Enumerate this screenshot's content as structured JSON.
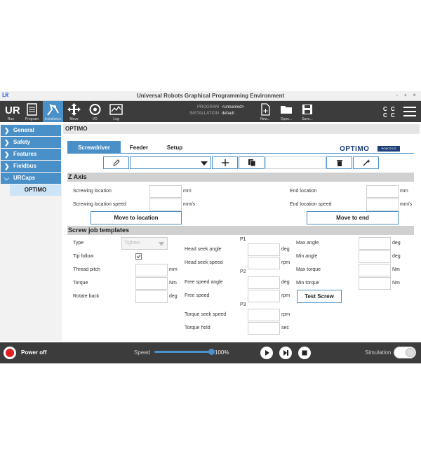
{
  "window": {
    "title": "Universal Robots Graphical Programming Environment",
    "controls": "- + ×"
  },
  "header": {
    "tabs": [
      {
        "label": "Run"
      },
      {
        "label": "Program"
      },
      {
        "label": "Installation"
      },
      {
        "label": "Move"
      },
      {
        "label": "I/O"
      },
      {
        "label": "Log"
      }
    ],
    "program_label": "PROGRAM",
    "program_value": "<unnamed>",
    "installation_label": "INSTALLATION",
    "installation_value": "default",
    "file_buttons": [
      {
        "label": "New..."
      },
      {
        "label": "Open..."
      },
      {
        "label": "Save..."
      }
    ]
  },
  "sidebar": {
    "items": [
      {
        "label": "General"
      },
      {
        "label": "Safety"
      },
      {
        "label": "Features"
      },
      {
        "label": "Fieldbus"
      },
      {
        "label": "URCaps"
      }
    ],
    "sub_item": "OPTIMO"
  },
  "panel": {
    "title": "OPTIMO",
    "tabs": [
      {
        "label": "Screwdriver"
      },
      {
        "label": "Feeder"
      },
      {
        "label": "Setup"
      }
    ],
    "brand": "OPTIMO",
    "brand_badge": "ROBOTICS"
  },
  "zaxis": {
    "title": "Z Axis",
    "screwing_location": "Screwing location",
    "screwing_location_unit": "mm",
    "screwing_location_speed": "Screwing location speed",
    "screwing_speed_unit": "mm/s",
    "end_location": "End location",
    "end_location_unit": "mm",
    "end_location_speed": "End location speed",
    "end_speed_unit": "mm/s",
    "move_to_location": "Move to location",
    "move_to_end": "Move to end"
  },
  "templates": {
    "title": "Screw job templates",
    "type_label": "Type",
    "type_value": "Tighten",
    "tip_follow": "Tip follow",
    "tip_follow_checked": true,
    "thread_pitch": "Thread pitch",
    "thread_pitch_unit": "mm",
    "torque": "Torque",
    "torque_unit": "Nm",
    "rotate_back": "Rotate back",
    "rotate_back_unit": "deg",
    "p1": "P1",
    "p2": "P2",
    "p3": "P3",
    "head_seek_angle": "Head seek angle",
    "head_seek_angle_unit": "deg",
    "head_seek_speed": "Head seek speed",
    "head_seek_speed_unit": "rpm",
    "free_speed_angle": "Free speed angle",
    "free_speed_angle_unit": "deg",
    "free_speed": "Free speed",
    "free_speed_unit": "rpm",
    "torque_seek_speed": "Torque seek speed",
    "torque_seek_speed_unit": "rpm",
    "torque_hold": "Torque hold",
    "torque_hold_unit": "sec",
    "max_angle": "Max angle",
    "max_angle_unit": "deg",
    "min_angle": "Min angle",
    "min_angle_unit": "deg",
    "max_torque": "Max torque",
    "max_torque_unit": "Nm",
    "min_torque": "Min torque",
    "min_torque_unit": "Nm",
    "test_screw": "Test Screw"
  },
  "footer": {
    "power_off": "Power off",
    "speed_label": "Speed",
    "speed_value": "100%",
    "speed_fraction": 1.0,
    "simulation_label": "Simulation",
    "simulation_on": false
  },
  "colors": {
    "accent": "#4a90c8",
    "header_bg": "#3c3c3c",
    "power_red": "#e02020",
    "brand": "#1d3f7a"
  }
}
